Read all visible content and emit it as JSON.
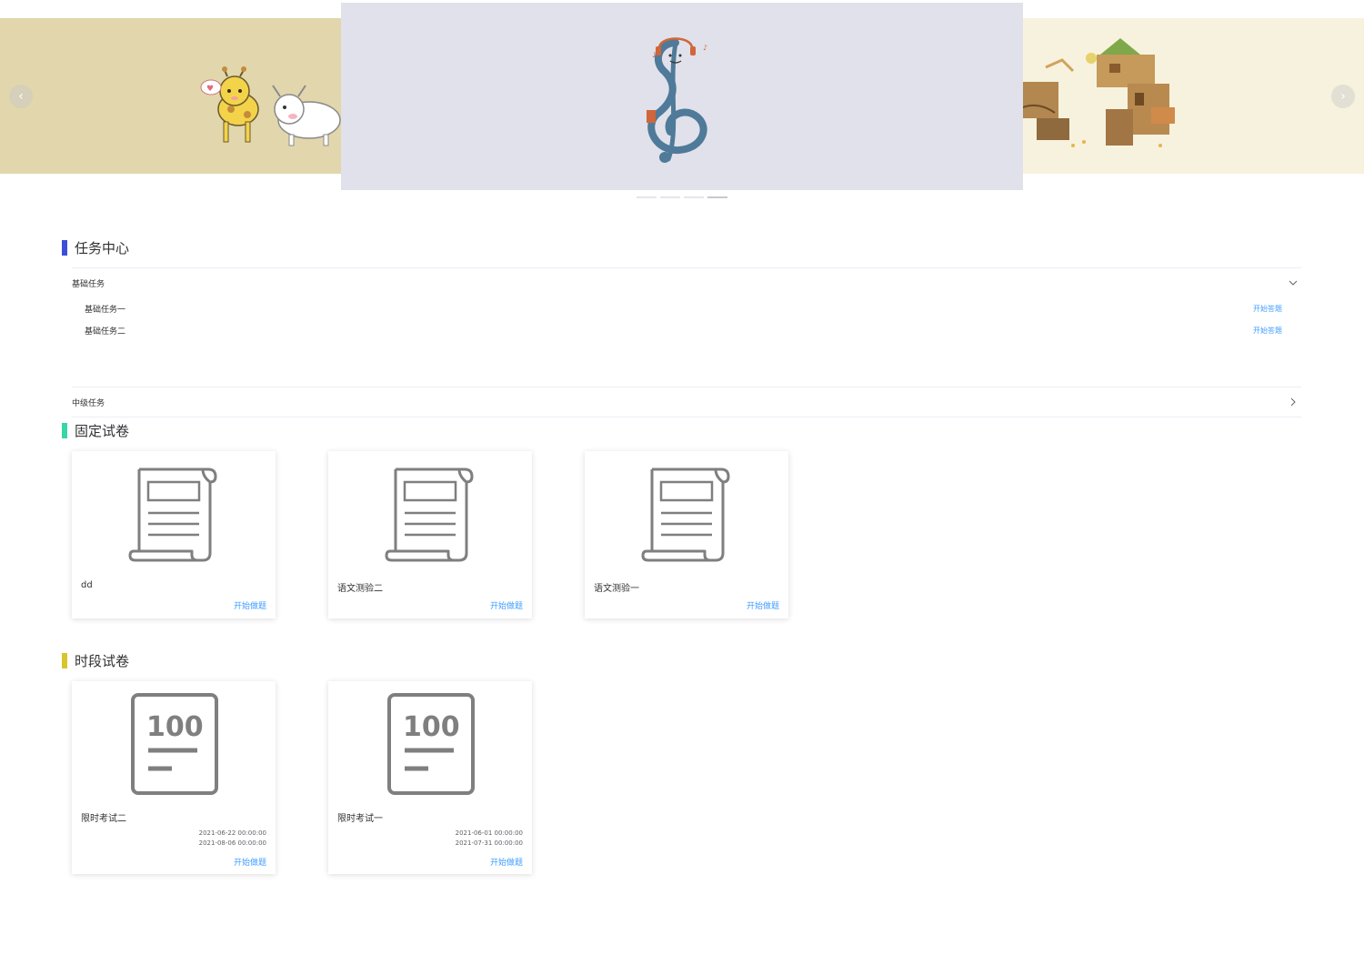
{
  "carousel": {
    "prev_label": "‹",
    "next_label": "›",
    "indicator_count": 4,
    "active_index": 3
  },
  "sections": {
    "task_center": {
      "title": "任务中心",
      "color": "#3b4fd8"
    },
    "fixed_papers": {
      "title": "固定试卷",
      "color": "#36d6a8"
    },
    "timed_papers": {
      "title": "时段试卷",
      "color": "#d8c52c"
    }
  },
  "task_center": {
    "groups": [
      {
        "title": "基础任务",
        "expanded": true,
        "tasks": [
          {
            "name": "基础任务一",
            "action": "开始答题"
          },
          {
            "name": "基础任务二",
            "action": "开始答题"
          }
        ]
      },
      {
        "title": "中级任务",
        "expanded": false,
        "tasks": []
      }
    ]
  },
  "fixed_papers": [
    {
      "title": "dd",
      "action": "开始做题",
      "icon": "scroll-document-icon"
    },
    {
      "title": "语文测验二",
      "action": "开始做题",
      "icon": "scroll-document-icon"
    },
    {
      "title": "语文测验一",
      "action": "开始做题",
      "icon": "scroll-document-icon"
    }
  ],
  "timed_papers": [
    {
      "title": "限时考试二",
      "start": "2021-06-22 00:00:00",
      "end": "2021-08-06 00:00:00",
      "action": "开始做题",
      "icon": "score-100-icon",
      "score_text": "100"
    },
    {
      "title": "限时考试一",
      "start": "2021-06-01 00:00:00",
      "end": "2021-07-31 00:00:00",
      "action": "开始做题",
      "icon": "score-100-icon",
      "score_text": "100"
    }
  ],
  "colors": {
    "link": "#409eff",
    "icon_gray": "#7f7f7f"
  }
}
